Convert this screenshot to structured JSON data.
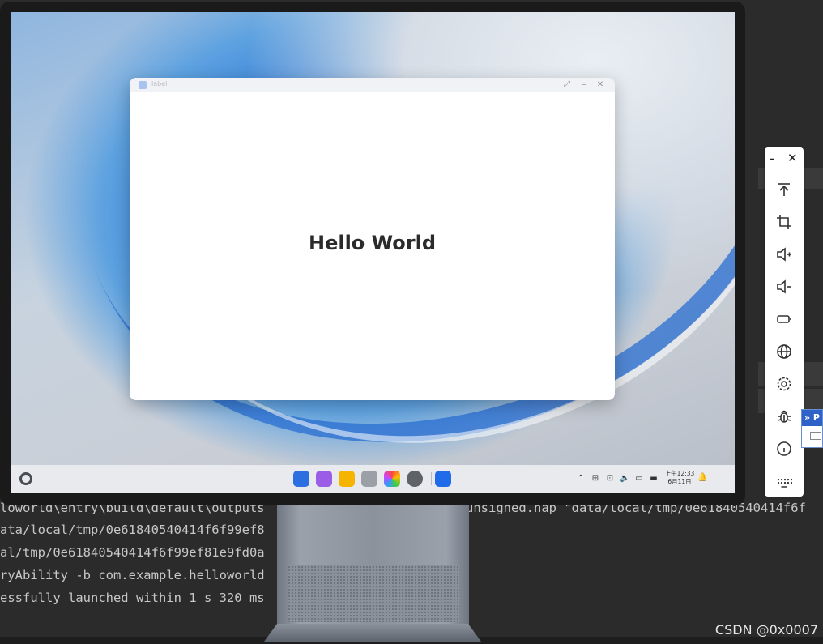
{
  "app_window": {
    "title": "label",
    "content_text": "Hello World"
  },
  "taskbar": {
    "clock_time": "上午12:33",
    "clock_date": "6月11日"
  },
  "terminal": {
    "lines": [
      "loworld\\entry\\build\\default\\outputs",
      "ata/local/tmp/0e61840540414f6f99ef8",
      "al/tmp/0e61840540414f6f99ef81e9fd0a",
      "ryAbility -b com.example.helloworld",
      "essfully launched within 1 s 320 ms"
    ],
    "line_right": "unsigned.hap \"data/local/tmp/0e61840540414f6f"
  },
  "side_popup": {
    "header": "» P"
  },
  "watermark": "CSDN @0x0007"
}
